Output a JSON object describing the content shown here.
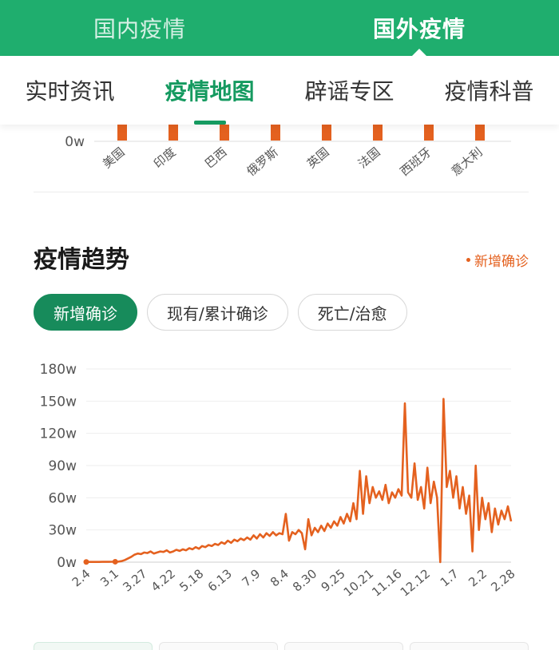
{
  "top_tabs": [
    {
      "label": "国内疫情",
      "active": false
    },
    {
      "label": "国外疫情",
      "active": true
    }
  ],
  "sub_tabs": [
    {
      "label": "实时资讯",
      "active": false
    },
    {
      "label": "疫情地图",
      "active": true
    },
    {
      "label": "辟谣专区",
      "active": false
    },
    {
      "label": "疫情科普",
      "active": false
    }
  ],
  "colors": {
    "header_green": "#1fae6e",
    "accent_green": "#159a60",
    "series_orange": "#e4611f"
  },
  "country_bar_chart": {
    "y_label_visible": "0w",
    "countries": [
      "美国",
      "印度",
      "巴西",
      "俄罗斯",
      "英国",
      "法国",
      "西班牙",
      "意大利"
    ]
  },
  "trend": {
    "title": "疫情趋势",
    "legend_label": "新增确诊",
    "chips": [
      {
        "label": "新增确诊",
        "active": true
      },
      {
        "label": "现有/累计确诊",
        "active": false
      },
      {
        "label": "死亡/治愈",
        "active": false
      }
    ]
  },
  "chart_data": {
    "type": "line",
    "title": "疫情趋势",
    "ylim": [
      0,
      180
    ],
    "y_ticks": [
      "0w",
      "30w",
      "60w",
      "90w",
      "120w",
      "150w",
      "180w"
    ],
    "x_ticks": [
      "2.4",
      "3.1",
      "3.27",
      "4.22",
      "5.18",
      "6.13",
      "7.9",
      "8.4",
      "8.30",
      "9.25",
      "10.21",
      "11.16",
      "12.12",
      "1.7",
      "2.2",
      "2.28"
    ],
    "grid": true,
    "series": [
      {
        "name": "新增确诊",
        "unit": "w",
        "values": [
          0.2,
          0.2,
          0.2,
          0.2,
          0.2,
          0.3,
          0.3,
          0.3,
          0.4,
          0.4,
          0.5,
          1.0,
          2.0,
          3.5,
          5.0,
          7.0,
          8.0,
          7.5,
          9.0,
          8.5,
          10.0,
          8.0,
          9.0,
          10.0,
          9.5,
          11.0,
          9.0,
          10.0,
          11.5,
          10.5,
          12.0,
          11.0,
          13.0,
          12.0,
          14.0,
          12.5,
          15.0,
          14.0,
          16.0,
          15.0,
          17.0,
          16.0,
          18.5,
          17.0,
          20.0,
          18.0,
          21.0,
          19.5,
          22.0,
          20.5,
          23.0,
          21.0,
          25.0,
          22.0,
          26.0,
          23.0,
          27.0,
          24.5,
          28.0,
          25.0,
          27.0,
          26.0,
          45.0,
          20.0,
          28.0,
          26.0,
          30.0,
          27.0,
          12.0,
          40.0,
          25.0,
          32.0,
          28.0,
          34.0,
          29.0,
          36.0,
          32.0,
          38.0,
          34.0,
          42.0,
          36.0,
          45.0,
          38.0,
          55.0,
          40.0,
          85.0,
          45.0,
          80.0,
          55.0,
          70.0,
          60.0,
          66.0,
          58.0,
          72.0,
          55.0,
          65.0,
          60.0,
          68.0,
          62.0,
          148.0,
          65.0,
          60.0,
          92.0,
          58.0,
          70.0,
          50.0,
          88.0,
          55.0,
          75.0,
          60.0,
          0.0,
          152.0,
          70.0,
          85.0,
          60.0,
          80.0,
          50.0,
          70.0,
          45.0,
          62.0,
          10.0,
          90.0,
          30.0,
          60.0,
          40.0,
          55.0,
          28.0,
          50.0,
          35.0,
          48.0,
          40.0,
          52.0,
          38.0
        ]
      }
    ]
  }
}
